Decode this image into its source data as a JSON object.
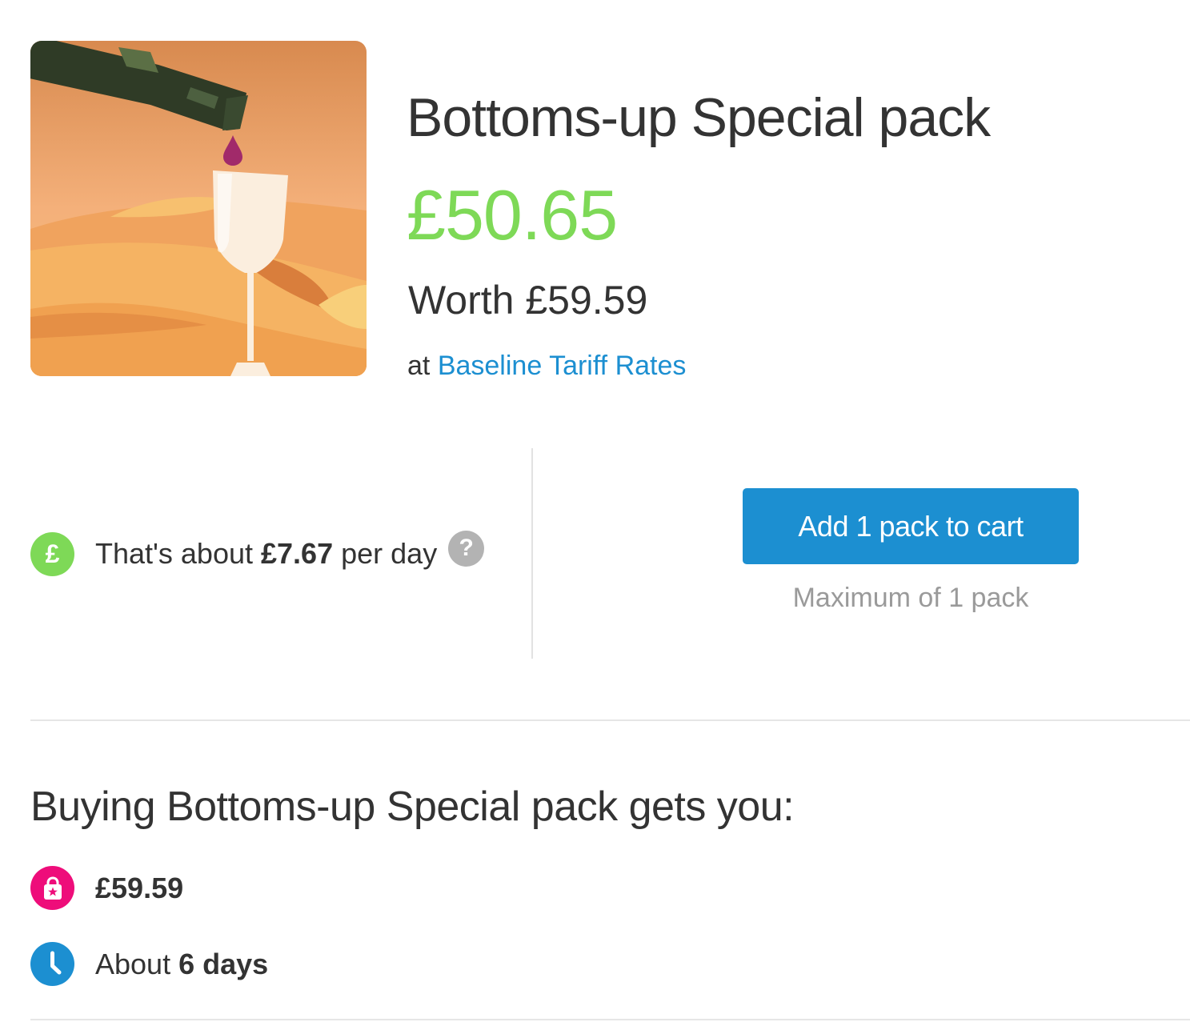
{
  "product": {
    "title": "Bottoms-up Special pack",
    "price": "£50.65",
    "worth": "Worth £59.59",
    "tariff_prefix": "at",
    "tariff_link": "Baseline Tariff Rates",
    "image_icon": "wine-pour-desert-illustration"
  },
  "cost": {
    "icon": "pound-icon",
    "prefix": "That's about",
    "amount": "£7.67",
    "suffix": "per day",
    "help_symbol": "?"
  },
  "cart": {
    "button_label": "Add 1 pack to cart",
    "max_note": "Maximum of 1 pack"
  },
  "benefits": {
    "heading": "Buying Bottoms-up Special pack gets you:",
    "items": [
      {
        "icon": "shopping-bag-star-icon",
        "prefix": "",
        "value": "£59.59"
      },
      {
        "icon": "clock-icon",
        "prefix": "About",
        "value": "6 days"
      }
    ]
  },
  "colors": {
    "price_green": "#7ed957",
    "link_blue": "#1c8fd1",
    "button_blue": "#1c8fd1",
    "badge_pink": "#ee0d7a",
    "muted_grey": "#9a9a9a"
  }
}
